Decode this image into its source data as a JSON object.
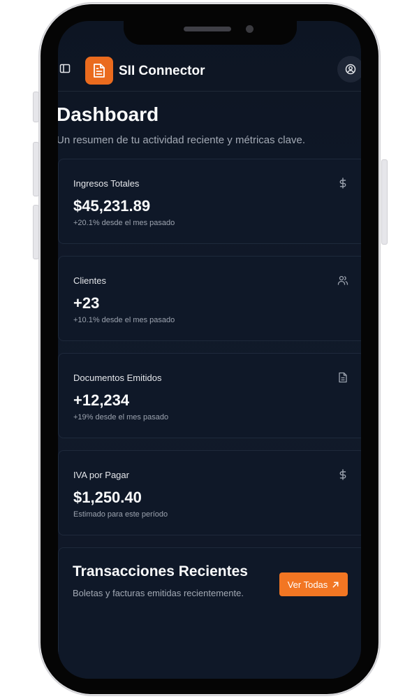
{
  "app": {
    "title": "SII Connector"
  },
  "page": {
    "title": "Dashboard",
    "subtitle": "Un resumen de tu actividad reciente y métricas clave."
  },
  "cards": [
    {
      "label": "Ingresos Totales",
      "value": "$45,231.89",
      "sub": "+20.1% desde el mes pasado",
      "icon": "dollar-icon"
    },
    {
      "label": "Clientes",
      "value": "+23",
      "sub": "+10.1% desde el mes pasado",
      "icon": "users-icon"
    },
    {
      "label": "Documentos Emitidos",
      "value": "+12,234",
      "sub": "+19% desde el mes pasado",
      "icon": "document-icon"
    },
    {
      "label": "IVA por Pagar",
      "value": "$1,250.40",
      "sub": "Estimado para este período",
      "icon": "dollar-icon"
    }
  ],
  "transactions": {
    "title": "Transacciones Recientes",
    "subtitle": "Boletas y facturas emitidas recientemente.",
    "button_label": "Ver Todas",
    "button_icon": "arrow-up-right-icon"
  },
  "colors": {
    "accent": "#f27623",
    "logo_bg": "#ea6b1e",
    "background": "#0d1523",
    "card_bg": "#0f1828",
    "text_primary": "#f9fafb",
    "text_muted": "#9ca3af"
  }
}
